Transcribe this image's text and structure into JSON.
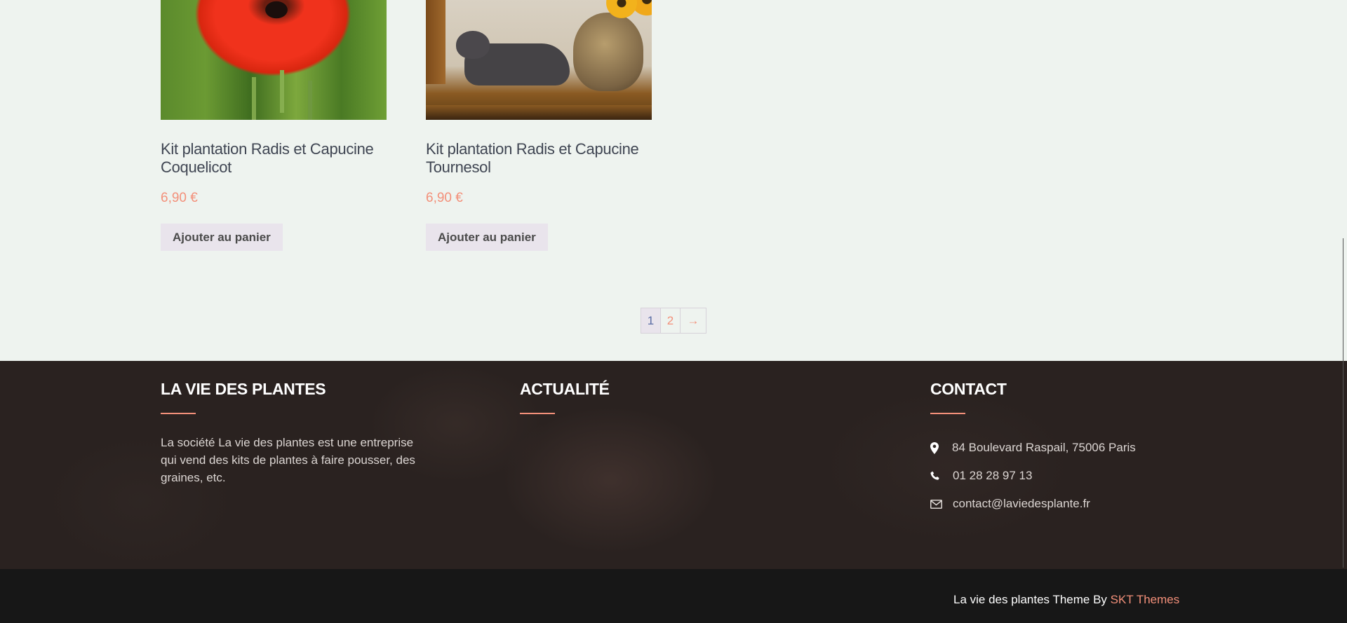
{
  "products": [
    {
      "title": "Kit plantation Radis et Capucine Coquelicot",
      "price": "6,90 €",
      "button": "Ajouter au panier",
      "image_subject": "red poppy flower"
    },
    {
      "title": "Kit plantation Radis et Capucine Tournesol",
      "price": "6,90 €",
      "button": "Ajouter au panier",
      "image_subject": "cat beside sunflower vase"
    }
  ],
  "pagination": {
    "current": "1",
    "next_page": "2",
    "next_arrow": "→"
  },
  "footer": {
    "about": {
      "heading": "LA VIE DES PLANTES",
      "text": "La société La vie des plantes est une entreprise qui vend des kits de plantes à faire pousser, des graines, etc."
    },
    "news": {
      "heading": "ACTUALITÉ"
    },
    "contact": {
      "heading": "CONTACT",
      "address": "84 Boulevard Raspail, 75006 Paris",
      "phone": "01 28 28 97 13",
      "email": "contact@laviedesplante.fr"
    },
    "credit_prefix": "La vie des plantes Theme By ",
    "credit_brand": "SKT Themes"
  },
  "colors": {
    "accent": "#f3907a",
    "background": "#eef3ef",
    "footer_bg": "#2a2220",
    "bottom_bar": "#171717",
    "button_bg": "#e9e4ec"
  },
  "icons": [
    "map-pin-icon",
    "phone-icon",
    "envelope-icon"
  ]
}
